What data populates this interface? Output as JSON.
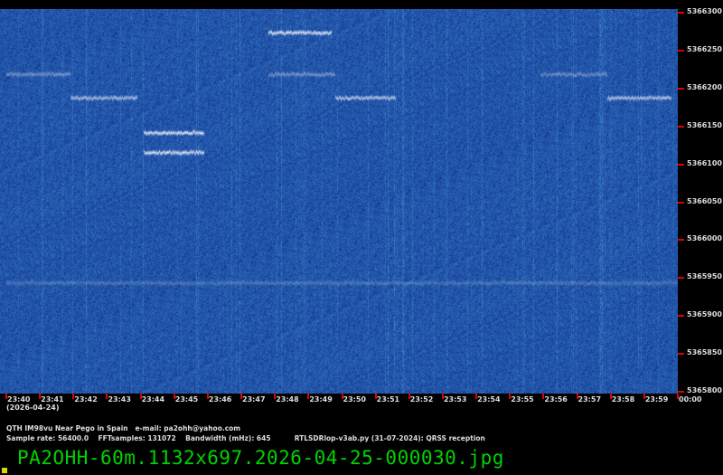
{
  "spectrogram": {
    "freq_min_hz": 5365800,
    "freq_max_hz": 5366300,
    "freq_ticks": [
      "5366300",
      "5366250",
      "5366200",
      "5366150",
      "5366100",
      "5366050",
      "5366000",
      "5365950",
      "5365900",
      "5365850",
      "5365800"
    ],
    "time_start_min": 0,
    "time_end_min": 20,
    "time_ticks": [
      "23:40",
      "23:41",
      "23:42",
      "23:43",
      "23:44",
      "23:45",
      "23:46",
      "23:47",
      "23:48",
      "23:49",
      "23:50",
      "23:51",
      "23:52",
      "23:53",
      "23:54",
      "23:55",
      "23:56",
      "23:57",
      "23:58",
      "23:59",
      "00:00"
    ],
    "date": "(2026-04-24)",
    "background_color": "#1f4fa8",
    "signals": [
      {
        "freq": 5366219,
        "t0": 0.0,
        "t1": 1.9,
        "strength": 0.45
      },
      {
        "freq": 5366219,
        "t0": 7.8,
        "t1": 9.8,
        "strength": 0.45
      },
      {
        "freq": 5366219,
        "t0": 15.9,
        "t1": 17.9,
        "strength": 0.4
      },
      {
        "freq": 5366188,
        "t0": 1.9,
        "t1": 3.9,
        "strength": 0.75
      },
      {
        "freq": 5366188,
        "t0": 9.8,
        "t1": 11.6,
        "strength": 0.8
      },
      {
        "freq": 5366188,
        "t0": 17.9,
        "t1": 19.8,
        "strength": 0.8
      },
      {
        "freq": 5366274,
        "t0": 7.8,
        "t1": 9.7,
        "strength": 1.0
      },
      {
        "freq": 5366142,
        "t0": 4.1,
        "t1": 5.9,
        "strength": 1.0
      },
      {
        "freq": 5366116,
        "t0": 4.1,
        "t1": 5.9,
        "strength": 1.0
      },
      {
        "freq": 5365944,
        "t0": 0.0,
        "t1": 20.0,
        "strength": 0.25
      }
    ]
  },
  "info": {
    "line1": "QTH IM98vu Near Pego in Spain   e-mail: pa2ohh@yahoo.com",
    "line2": "Sample rate: 56400.0    FFTsamples: 131072    Bandwidth (mHz): 645          RTLSDRlop-v3ab.py (31-07-2024): QRSS reception"
  },
  "filename": "PA2OHH-60m.1132x697.2026-04-25-000030.jpg"
}
